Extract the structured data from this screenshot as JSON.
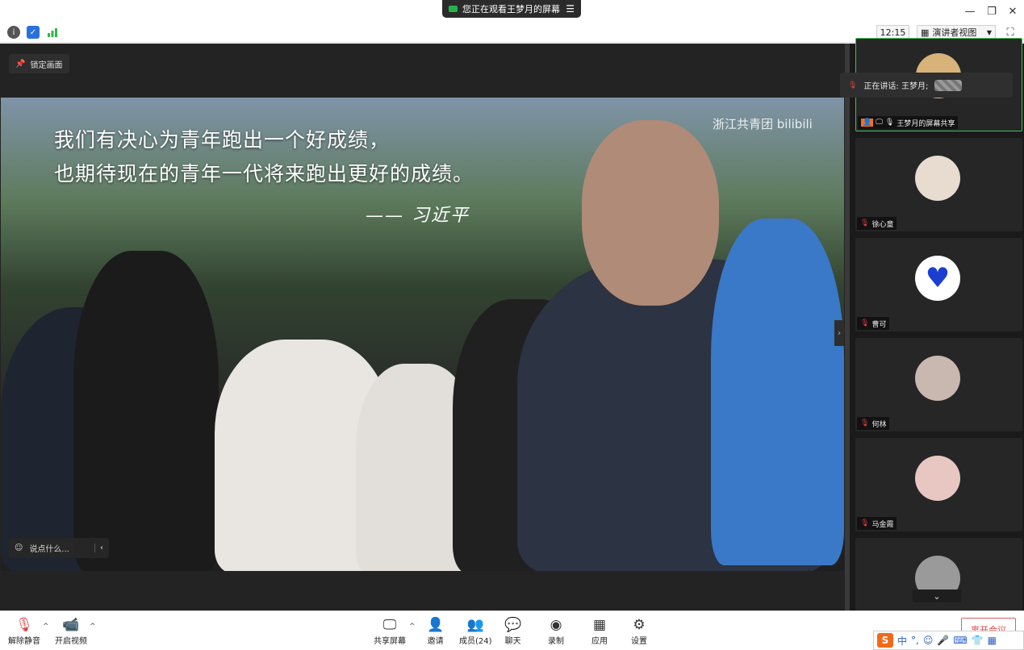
{
  "titlebar": {
    "share_banner": "您正在观看王梦月的屏幕",
    "menu_glyph": "☰",
    "minimize": "—",
    "restore": "❐",
    "close": "✕"
  },
  "toolbar": {
    "clock": "12:15",
    "view_mode": "演讲者视图",
    "info_glyph": "i",
    "security_glyph": "✓"
  },
  "stage": {
    "lock_label": "锁定画面",
    "chat_placeholder": "说点什么...",
    "chat_collapse": "‹",
    "scroll_right": "›",
    "shared_content": {
      "quote_line1": "我们有决心为青年跑出一个好成绩，",
      "quote_line2": "也期待现在的青年一代将来跑出更好的成绩。",
      "signature": "—— 习近平",
      "watermark": "浙江共青团 bilibili"
    }
  },
  "side_panel": {
    "speaking_popup": "正在讲话: 王梦月;",
    "tiles": [
      {
        "name": "王梦月的屏幕共享",
        "avatar_color": "#d7b37a",
        "active": true
      },
      {
        "name": "徐心童",
        "avatar_color": "#e7dccf",
        "active": false
      },
      {
        "name": "曹可",
        "avatar_color": "#ffffff",
        "active": false
      },
      {
        "name": "何林",
        "avatar_color": "#c9b8b0",
        "active": false
      },
      {
        "name": "马金霞",
        "avatar_color": "#e8c7c2",
        "active": false
      },
      {
        "name": "",
        "avatar_color": "#9a9a9a",
        "active": false
      }
    ],
    "scroll_down": "⌄"
  },
  "bottombar": {
    "unmute": "解除静音",
    "start_video": "开启视频",
    "share_screen": "共享屏幕",
    "invite": "邀请",
    "members": "成员(24)",
    "chat": "聊天",
    "record": "录制",
    "apps": "应用",
    "settings": "设置",
    "end_meeting": "离开会议",
    "caret": "^"
  },
  "ime": {
    "logo": "S",
    "mode": "中",
    "punct": "°,",
    "emoji": "☺",
    "mic": "🎤",
    "keyboard": "⌨"
  }
}
